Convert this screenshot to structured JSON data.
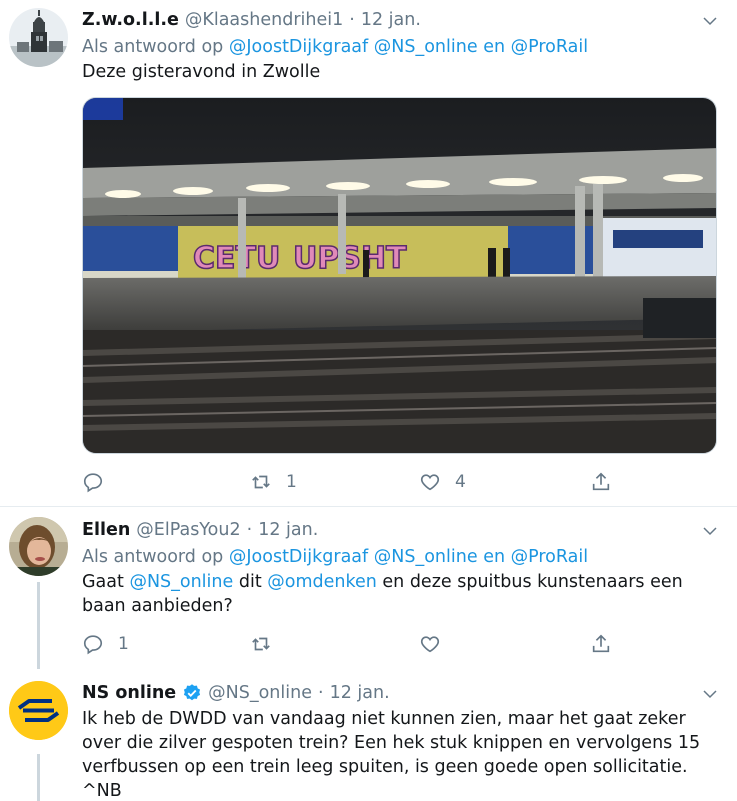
{
  "tweets": [
    {
      "name": "Z.w.o.l.l.e",
      "handle": "@Klaashendrihei1",
      "date": "12 jan.",
      "reply_prefix": "Als antwoord op",
      "reply_mentions": [
        "@JoostDijkgraaf",
        "@NS_online",
        "en",
        "@ProRail"
      ],
      "text": "Deze gisteravond in Zwolle",
      "retweets": "1",
      "likes": "4"
    },
    {
      "name": "Ellen",
      "handle": "@ElPasYou2",
      "date": "12 jan.",
      "reply_prefix": "Als antwoord op",
      "reply_mentions": [
        "@JoostDijkgraaf",
        "@NS_online",
        "en",
        "@ProRail"
      ],
      "text_parts": [
        "Gaat ",
        "@NS_online",
        " dit ",
        "@omdenken",
        " en deze spuitbus kunstenaars een baan aanbieden?"
      ],
      "replies": "1"
    },
    {
      "name": "NS online",
      "handle": "@NS_online",
      "date": "12 jan.",
      "text_lines": [
        "Ik heb de DWDD van vandaag niet kunnen zien, maar het gaat zeker",
        "over die zilver gespoten trein? Een hek stuk knippen en vervolgens 15",
        "verfbussen op een trein leeg spuiten, is geen goede open sollicitatie.",
        "^NB"
      ]
    }
  ],
  "dot": "·",
  "colors": {
    "link": "#1b95e0",
    "muted": "#657786",
    "text": "#14171a",
    "ns_yellow": "#ffc917",
    "ns_blue": "#003082"
  },
  "icons": [
    "reply-icon",
    "retweet-icon",
    "like-icon",
    "share-icon",
    "chevron-down-icon",
    "verified-icon",
    "ns-logo-icon"
  ]
}
